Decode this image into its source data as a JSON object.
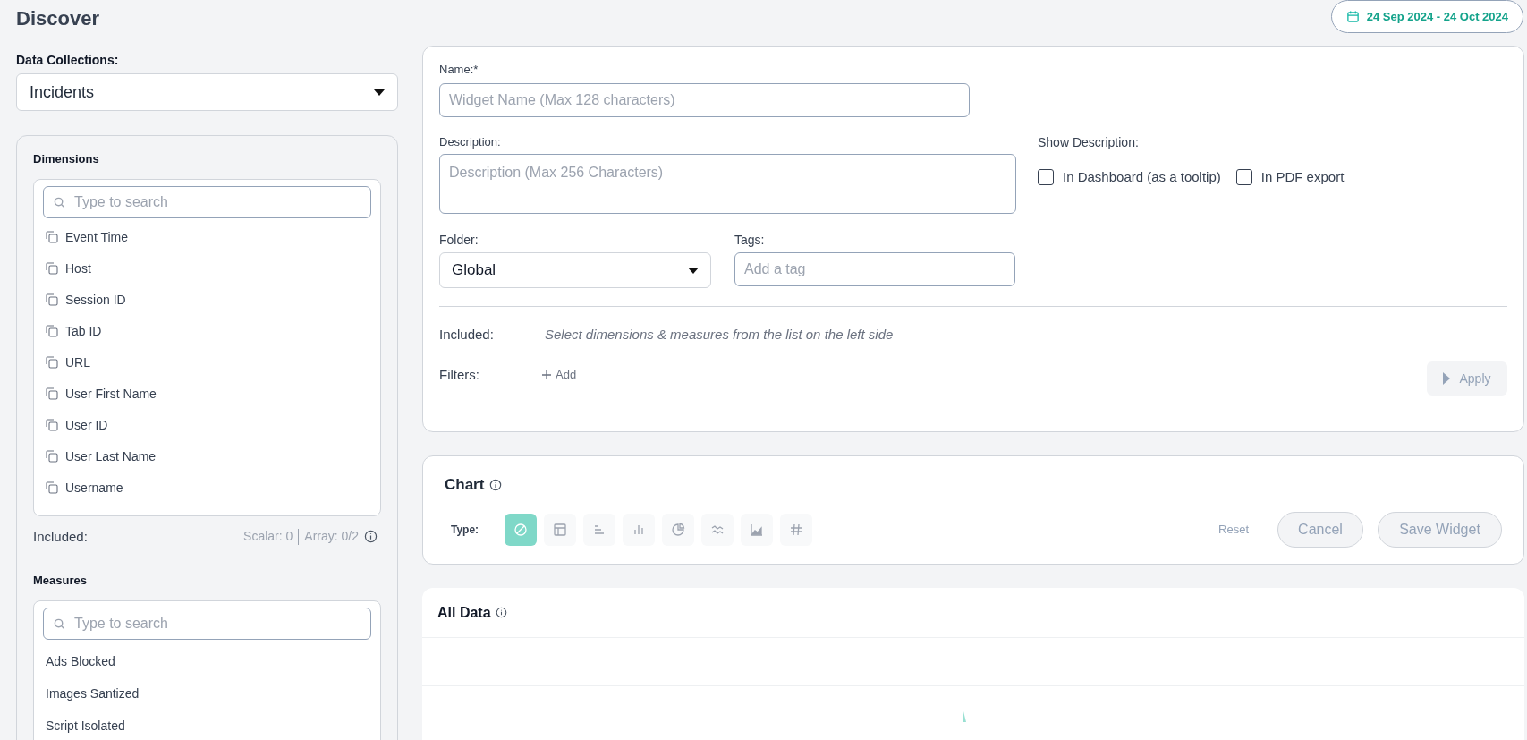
{
  "page_title": "Discover",
  "date_range": "24 Sep 2024 - 24 Oct 2024",
  "data_collection": {
    "label": "Data Collections:",
    "value": "Incidents"
  },
  "dimensions": {
    "title": "Dimensions",
    "search_placeholder": "Type to search",
    "items": [
      "Event Time",
      "Host",
      "Session ID",
      "Tab ID",
      "URL",
      "User First Name",
      "User ID",
      "User Last Name",
      "Username"
    ],
    "included_label": "Included:",
    "scalar": "Scalar: 0",
    "array": "Array: 0/2"
  },
  "measures": {
    "title": "Measures",
    "search_placeholder": "Type to search",
    "items": [
      "Ads Blocked",
      "Images Santized",
      "Script Isolated"
    ]
  },
  "form": {
    "name_label": "Name:*",
    "name_placeholder": "Widget Name (Max 128 characters)",
    "description_label": "Description:",
    "description_placeholder": "Description (Max 256 Characters)",
    "show_description_label": "Show Description:",
    "show_description_options": [
      {
        "label": "In Dashboard (as a tooltip)",
        "checked": false
      },
      {
        "label": "In PDF export",
        "checked": false
      }
    ],
    "folder_label": "Folder:",
    "folder_value": "Global",
    "tags_label": "Tags:",
    "tags_placeholder": "Add a tag",
    "included_label": "Included:",
    "included_hint": "Select dimensions & measures from the list on the left side",
    "filters_label": "Filters:",
    "add_filter": "Add",
    "apply": "Apply"
  },
  "chart": {
    "title": "Chart",
    "type_label": "Type:",
    "types": [
      {
        "kind": "none",
        "selected": true
      },
      {
        "kind": "table",
        "selected": false
      },
      {
        "kind": "hbar",
        "selected": false
      },
      {
        "kind": "bar",
        "selected": false
      },
      {
        "kind": "pie",
        "selected": false
      },
      {
        "kind": "wave",
        "selected": false
      },
      {
        "kind": "area",
        "selected": false
      },
      {
        "kind": "number",
        "selected": false
      }
    ],
    "reset": "Reset",
    "cancel": "Cancel",
    "save": "Save Widget"
  },
  "all_data": {
    "title": "All Data"
  }
}
